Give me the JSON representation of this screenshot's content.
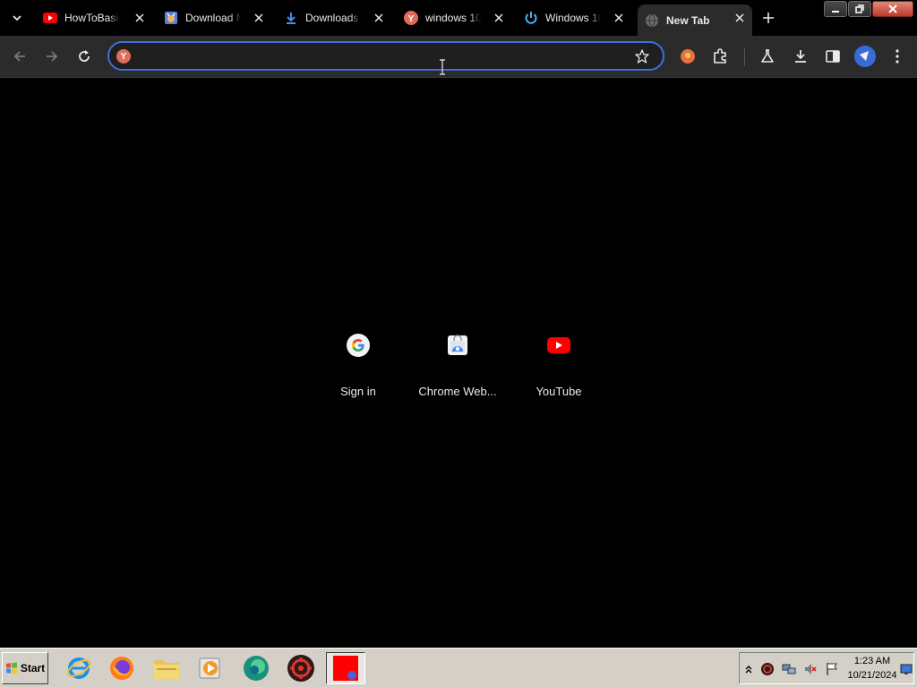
{
  "browser": {
    "tabs": [
      {
        "title": "HowToBasic",
        "icon": "youtube-icon"
      },
      {
        "title": "Download M",
        "icon": "download-site-icon"
      },
      {
        "title": "Downloads",
        "icon": "download-arrow-icon"
      },
      {
        "title": "windows 10",
        "icon": "yandex-icon"
      },
      {
        "title": "Windows 10",
        "icon": "power-icon"
      },
      {
        "title": "New Tab",
        "icon": "globe-icon",
        "active": true
      }
    ],
    "address_bar": {
      "value": "",
      "placeholder": ""
    },
    "accent_color": "#3f6fd8"
  },
  "shortcuts": [
    {
      "label": "Sign in",
      "icon": "google-icon"
    },
    {
      "label": "Chrome Web...",
      "icon": "chrome-web-store-icon"
    },
    {
      "label": "YouTube",
      "icon": "youtube-icon"
    }
  ],
  "taskbar": {
    "start_label": "Start",
    "apps": [
      "internet-explorer-icon",
      "firefox-icon",
      "file-explorer-icon",
      "media-player-icon",
      "edge-icon",
      "settings-app-icon",
      "red-window-icon"
    ],
    "clock": {
      "time": "1:23 AM",
      "date": "10/21/2024"
    }
  }
}
